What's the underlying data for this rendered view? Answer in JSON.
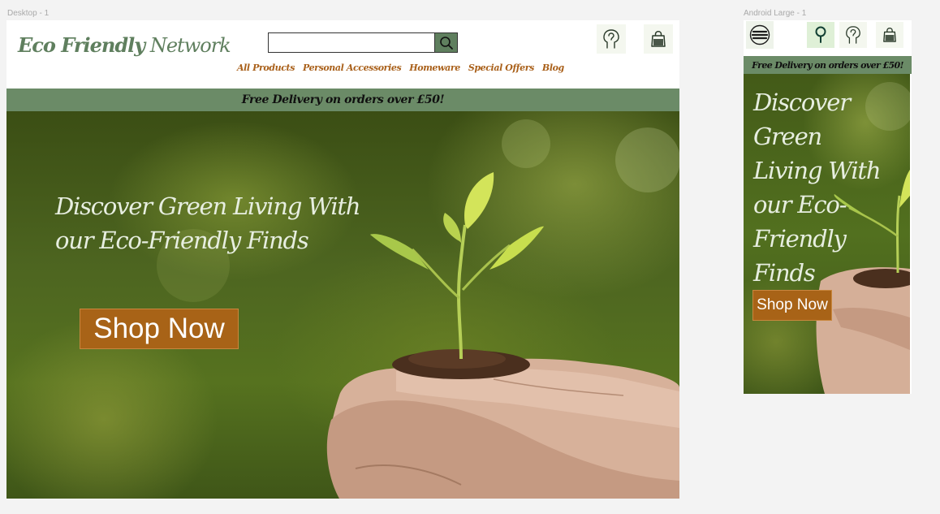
{
  "frames": {
    "desktop_label": "Desktop - 1",
    "mobile_label": "Android Large - 1"
  },
  "brand": {
    "logo_bold": "Eco Friendly",
    "logo_regular": " Network"
  },
  "search": {
    "value": "",
    "placeholder": ""
  },
  "nav": {
    "items": [
      "All Products",
      "Personal Accessories",
      "Homeware",
      "Special Offers",
      "Blog"
    ]
  },
  "banner": {
    "text": "Free Delivery on orders over £50!"
  },
  "hero": {
    "title": "Discover Green Living With our Eco-Friendly Finds",
    "cta_label": "Shop Now"
  },
  "icons": {
    "search": "search-icon",
    "account": "user-head-icon",
    "cart": "shopping-bag-icon",
    "menu": "hamburger-menu-icon"
  },
  "colors": {
    "brand_green": "#5f7f5e",
    "banner_green": "#6b8b67",
    "accent_orange": "#a86317",
    "nav_orange": "#a9601a",
    "hero_text": "#e7eee0"
  }
}
